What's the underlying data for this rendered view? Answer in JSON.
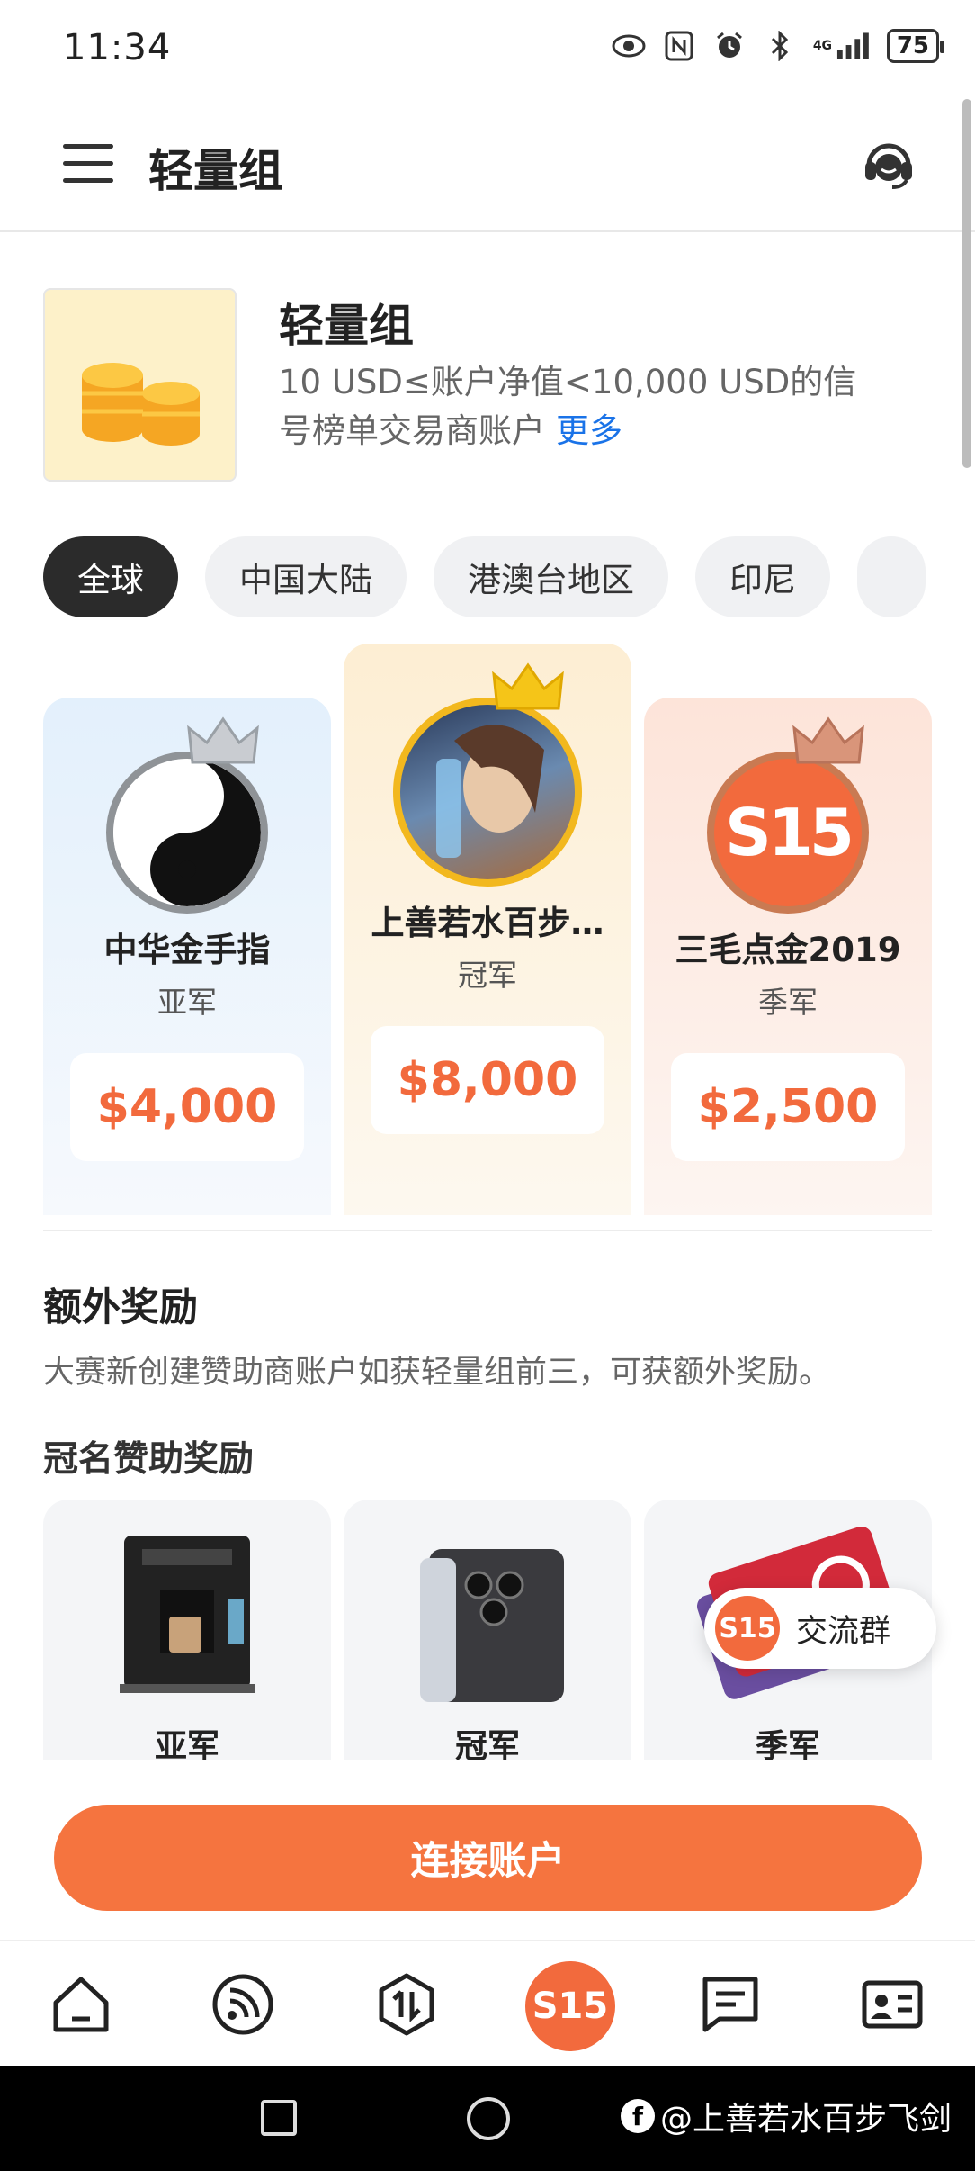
{
  "status_bar": {
    "time": "11:34",
    "network": "4G",
    "battery": "75"
  },
  "header": {
    "title": "轻量组"
  },
  "group": {
    "name": "轻量组",
    "description": "10 USD≤账户净值<10,000 USD的信号榜单交易商账户",
    "more_label": "更多"
  },
  "regions": [
    "全球",
    "中国大陆",
    "港澳台地区",
    "印尼"
  ],
  "podium": {
    "silver": {
      "name": "中华金手指",
      "rank": "亚军",
      "prize": "$4,000"
    },
    "gold": {
      "name": "上善若水百步…",
      "rank": "冠军",
      "prize": "$8,000"
    },
    "bronze": {
      "name": "三毛点金2019",
      "rank": "季军",
      "prize": "$2,500"
    }
  },
  "bonus": {
    "title": "额外奖励",
    "description": "大赛新创建赞助商账户如获轻量组前三，可获额外奖励。",
    "sponsor_title": "冠名赞助奖励",
    "cards": [
      {
        "label": "亚军"
      },
      {
        "label": "冠军"
      },
      {
        "label": "季军"
      }
    ]
  },
  "float_group": {
    "logo": "S15",
    "label": "交流群"
  },
  "cta": {
    "label": "连接账户"
  },
  "tab_bar": {
    "items": [
      "home-icon",
      "signal-icon",
      "trade-icon",
      "s15-logo",
      "message-icon",
      "profile-card-icon"
    ],
    "center_label": "S15"
  },
  "watermark": {
    "text": "@上善若水百步飞剑"
  },
  "colors": {
    "accent": "#f26a3d",
    "gold_bg": "#fdeed3",
    "silver_bg": "#e3f0fc",
    "bronze_bg": "#fde4d9"
  }
}
